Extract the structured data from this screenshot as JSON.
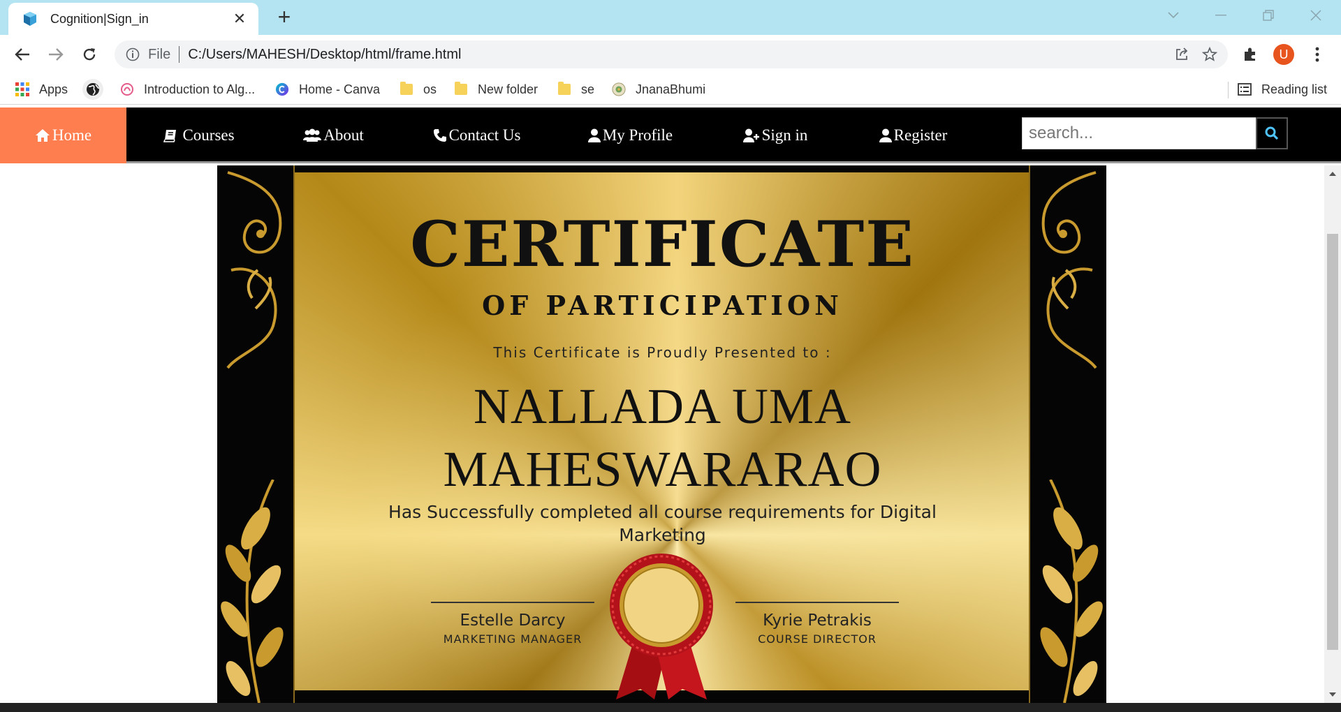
{
  "browser": {
    "tab_title": "Cognition|Sign_in",
    "url_scheme": "File",
    "url": "C:/Users/MAHESH/Desktop/html/frame.html",
    "profile_initial": "U",
    "bookmarks": [
      "Apps",
      "Introduction to Alg...",
      "Home - Canva",
      "os",
      "New folder",
      "se",
      "JnanaBhumi"
    ],
    "reading_list": "Reading list"
  },
  "navbar": {
    "items": [
      "Home",
      "Courses",
      "About",
      "Contact Us",
      "My Profile",
      "Sign in",
      "Register"
    ],
    "active": "Home",
    "search_placeholder": "search...",
    "colors": {
      "background": "#000000",
      "active": "#ff7e4f"
    }
  },
  "certificate": {
    "heading": "CERTIFICATE",
    "subheading": "OF PARTICIPATION",
    "presented_to": "This Certificate is Proudly Presented to :",
    "name_line1": "NALLADA UMA",
    "name_line2": "MAHESWARARAO",
    "description": "Has Successfully completed all course requirements for Digital Marketing",
    "signatures": [
      {
        "name": "Estelle Darcy",
        "title": "MARKETING MANAGER"
      },
      {
        "name": "Kyrie Petrakis",
        "title": "COURSE DIRECTOR"
      }
    ]
  }
}
